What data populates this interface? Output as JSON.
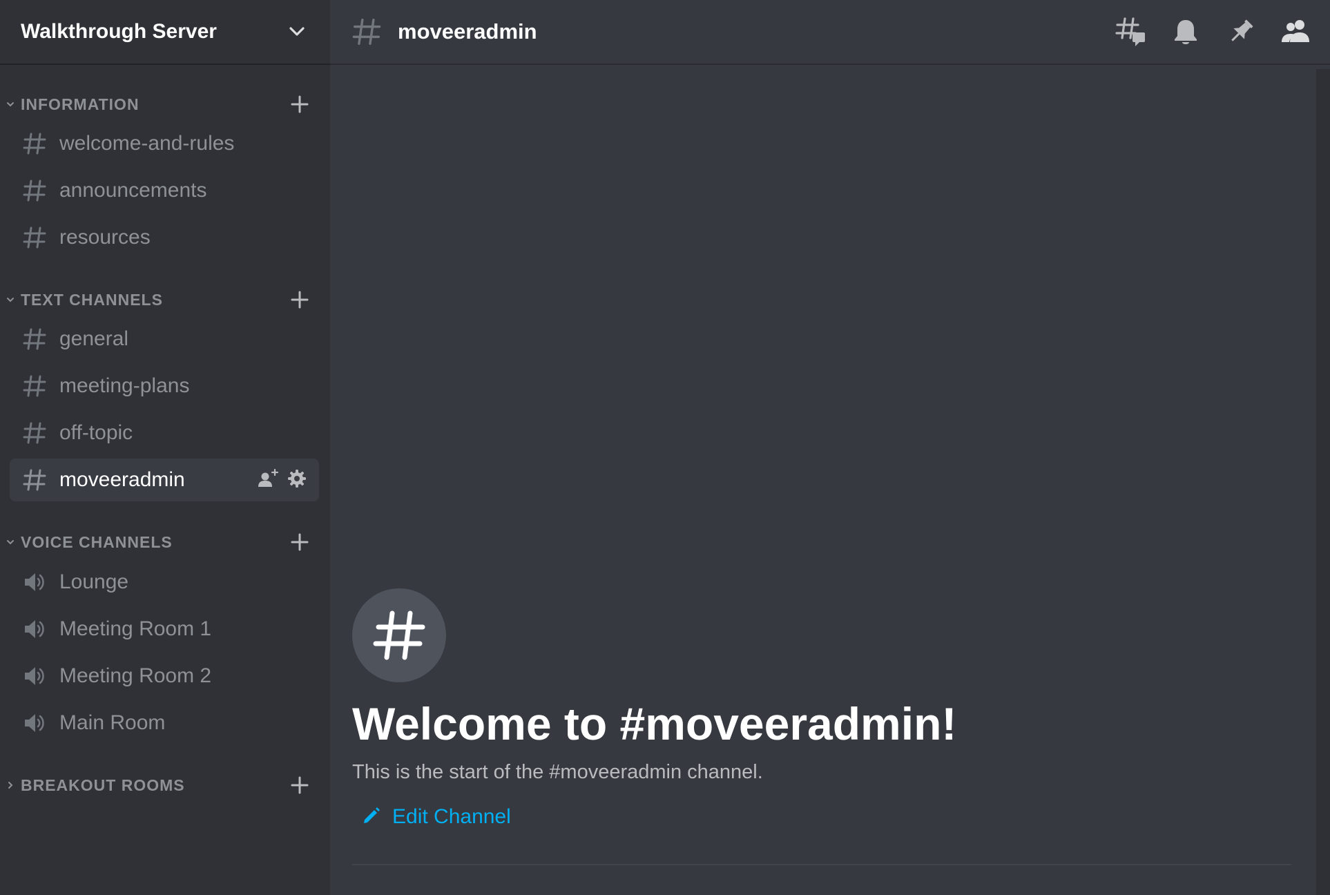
{
  "server": {
    "name": "Walkthrough Server",
    "menu_icon": "chevron-down-icon"
  },
  "sidebar": {
    "categories": [
      {
        "label": "INFORMATION",
        "expanded": true,
        "channels": [
          {
            "name": "welcome-and-rules",
            "type": "text"
          },
          {
            "name": "announcements",
            "type": "text"
          },
          {
            "name": "resources",
            "type": "text"
          }
        ]
      },
      {
        "label": "TEXT CHANNELS",
        "expanded": true,
        "channels": [
          {
            "name": "general",
            "type": "text"
          },
          {
            "name": "meeting-plans",
            "type": "text"
          },
          {
            "name": "off-topic",
            "type": "text"
          },
          {
            "name": "moveeradmin",
            "type": "text",
            "active": true
          }
        ]
      },
      {
        "label": "VOICE CHANNELS",
        "expanded": true,
        "channels": [
          {
            "name": "Lounge",
            "type": "voice"
          },
          {
            "name": "Meeting Room 1",
            "type": "voice"
          },
          {
            "name": "Meeting Room 2",
            "type": "voice"
          },
          {
            "name": "Main Room",
            "type": "voice"
          }
        ]
      },
      {
        "label": "BREAKOUT ROOMS",
        "expanded": false,
        "channels": []
      }
    ]
  },
  "topbar": {
    "channel_name": "moveeradmin",
    "icons": [
      "threads-icon",
      "bell-icon",
      "pin-icon",
      "members-icon"
    ]
  },
  "welcome": {
    "title": "Welcome to #moveeradmin!",
    "subtitle": "This is the start of the #moveeradmin channel.",
    "edit_label": "Edit Channel"
  },
  "colors": {
    "sidebar_bg": "#2f3136",
    "main_bg": "#36393f",
    "active_channel_bg": "#393c43",
    "muted_text": "#8e9297",
    "link": "#00b0f4"
  }
}
